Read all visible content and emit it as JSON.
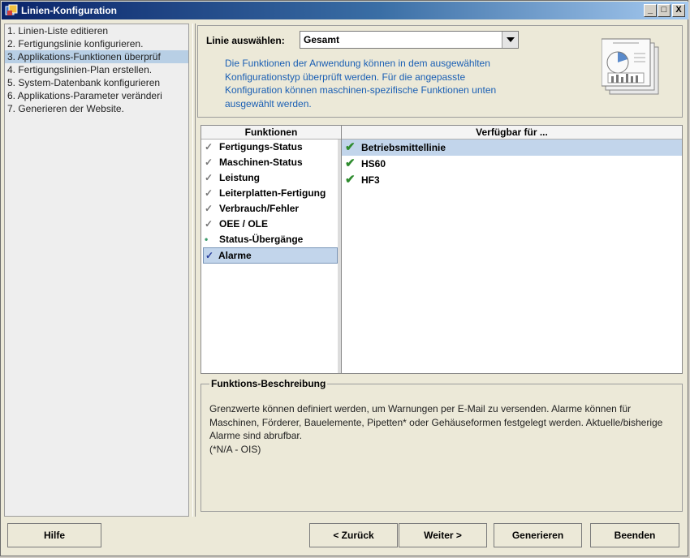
{
  "window": {
    "title": "Linien-Konfiguration"
  },
  "steps": [
    "1. Linien-Liste editieren",
    "2. Fertigungslinie konfigurieren.",
    "3. Applikations-Funktionen überprüf",
    "4. Fertigungslinien-Plan erstellen.",
    "5. System-Datenbank konfigurieren",
    "6. Applikations-Parameter veränderi",
    "7. Generieren der Website."
  ],
  "line_select": {
    "label": "Linie auswählen:",
    "value": "Gesamt"
  },
  "description": "Die Funktionen der Anwendung können in dem ausgewählten Konfigurationstyp überprüft werden. Für die angepasste Konfiguration können maschinen-spezifische Funktionen unten ausgewählt werden.",
  "functions": {
    "header": "Funktionen",
    "items": [
      {
        "label": "Fertigungs-Status",
        "icon": "check-outline-icon"
      },
      {
        "label": "Maschinen-Status",
        "icon": "check-outline-icon"
      },
      {
        "label": "Leistung",
        "icon": "check-outline-icon"
      },
      {
        "label": "Leiterplatten-Fertigung",
        "icon": "check-outline-icon"
      },
      {
        "label": "Verbrauch/Fehler",
        "icon": "check-outline-icon"
      },
      {
        "label": "OEE / OLE",
        "icon": "check-outline-icon"
      },
      {
        "label": "Status-Übergänge",
        "icon": "dot-icon"
      },
      {
        "label": "Alarme",
        "icon": "check-outline-icon"
      }
    ]
  },
  "available": {
    "header": "Verfügbar für ...",
    "items": [
      "Betriebsmittellinie",
      "HS60",
      "HF3"
    ]
  },
  "function_description": {
    "legend": "Funktions-Beschreibung",
    "text": "Grenzwerte können definiert werden, um Warnungen per E-Mail zu versenden. Alarme können für Maschinen, Förderer, Bauelemente, Pipetten* oder Gehäuseformen festgelegt werden. Aktuelle/bisherige Alarme sind abrufbar.",
    "note": "(*N/A - OIS)"
  },
  "buttons": {
    "help": "Hilfe",
    "back": "< Zurück",
    "next": "Weiter >",
    "generate": "Generieren",
    "finish": "Beenden"
  },
  "window_buttons": {
    "minimize": "_",
    "maximize": "□",
    "close": "X"
  },
  "colors": {
    "title_start": "#0a246a",
    "title_end": "#a6caf0",
    "selection": "#c2d5eb",
    "check": "#2e8b2e",
    "description_text": "#1a5fb4"
  }
}
